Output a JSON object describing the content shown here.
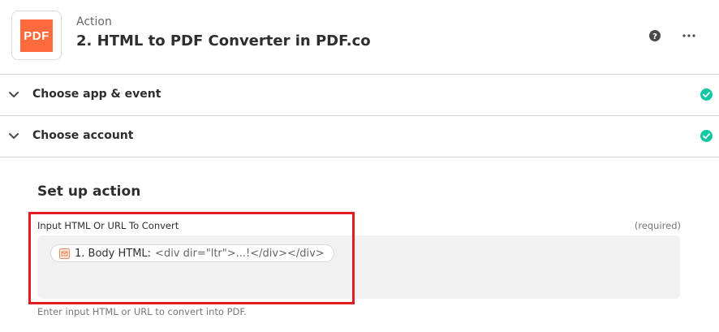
{
  "header": {
    "logo_text": "PDF",
    "step_type": "Action",
    "step_title": "2. HTML to PDF Converter in PDF.co",
    "help_icon": "question-circle-icon",
    "more_icon": "ellipsis-icon"
  },
  "sections": [
    {
      "label": "Choose app & event",
      "status": "complete"
    },
    {
      "label": "Choose account",
      "status": "complete"
    }
  ],
  "setup": {
    "title": "Set up action",
    "field": {
      "label": "Input HTML Or URL To Convert",
      "required_text": "(required)",
      "token": {
        "icon": "email-icon",
        "key": "1. Body HTML:",
        "value": "<div dir=\"ltr\">...!</div></div>"
      },
      "help_text": "Enter input HTML or URL to convert into PDF."
    }
  },
  "colors": {
    "logo_bg": "#ff6b3d",
    "success": "#13c7a3",
    "highlight": "#e31b23",
    "field_bg": "#f1f1f1"
  }
}
